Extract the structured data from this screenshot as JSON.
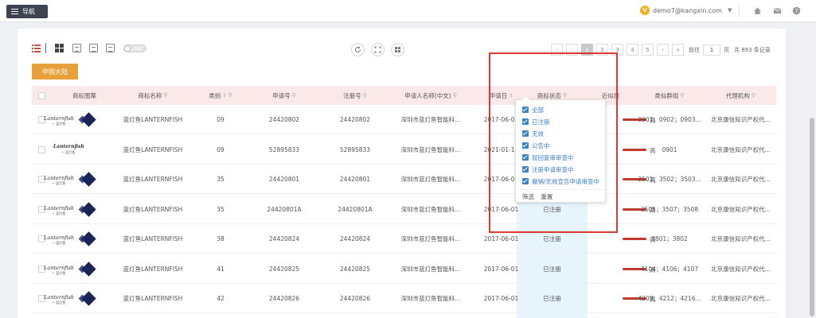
{
  "topbar": {
    "nav_label": "导航",
    "vip_label": "V",
    "user_email": "demo7@kangxin.com",
    "user_caret": "▼",
    "icons": [
      "home-icon",
      "mail-icon",
      "help-icon"
    ]
  },
  "toolbar": {
    "toggle_label": "关闭",
    "china_button": "中国大陆"
  },
  "pagination": {
    "pages": [
      "1",
      "2",
      "3",
      "4",
      "5"
    ],
    "active_page": "1",
    "goto_label": "前往",
    "page_value": "1",
    "page_unit": "页",
    "total": "共 893 条记录"
  },
  "table": {
    "columns": [
      "商标图案",
      "商标名称",
      "类别",
      "申请号",
      "注册号",
      "申请人名称(中文)",
      "申请日",
      "商标状态",
      "近似度",
      "类似群组",
      "代理机构"
    ],
    "rows": [
      {
        "name": "蓝灯鱼LANTERNFISH",
        "class": "09",
        "app_no": "24420802",
        "reg_no": "24420802",
        "applicant": "深圳市蓝灯鱼智能科...",
        "date": "2017-06-01",
        "status": "",
        "sim": "高",
        "groups": "0901；0902；0903...",
        "agency": "北京康信知识产权代...",
        "logo_type": "mark"
      },
      {
        "name": "蓝灯鱼LANTERNFISH",
        "class": "09",
        "app_no": "52895833",
        "reg_no": "52895833",
        "applicant": "深圳市蓝灯鱼智能科...",
        "date": "2021-01-11",
        "status": "",
        "sim": "高",
        "groups": "0901",
        "agency": "北京康信知识产权代...",
        "logo_type": "text"
      },
      {
        "name": "蓝灯鱼LANTERNFISH",
        "class": "35",
        "app_no": "24420801",
        "reg_no": "24420801",
        "applicant": "深圳市蓝灯鱼智能科...",
        "date": "2017-06-01",
        "status": "",
        "sim": "高",
        "groups": "3501；3502；3503...",
        "agency": "北京康信知识产权代...",
        "logo_type": "mark"
      },
      {
        "name": "蓝灯鱼LANTERNFISH",
        "class": "35",
        "app_no": "24420801A",
        "reg_no": "24420801A",
        "applicant": "深圳市蓝灯鱼智能科...",
        "date": "2017-06-01",
        "status": "已注册",
        "sim": "高",
        "groups": "3505；3507；3508",
        "agency": "北京康信知识产权代...",
        "logo_type": "mark"
      },
      {
        "name": "蓝灯鱼LANTERNFISH",
        "class": "38",
        "app_no": "24420824",
        "reg_no": "24420824",
        "applicant": "深圳市蓝灯鱼智能科...",
        "date": "2017-06-01",
        "status": "已注册",
        "sim": "高",
        "groups": "3801；3802",
        "agency": "北京康信知识产权代...",
        "logo_type": "mark"
      },
      {
        "name": "蓝灯鱼LANTERNFISH",
        "class": "41",
        "app_no": "24420825",
        "reg_no": "24420825",
        "applicant": "深圳市蓝灯鱼智能科...",
        "date": "2017-06-01",
        "status": "已注册",
        "sim": "高",
        "groups": "4104；4106；4107",
        "agency": "北京康信知识产权代...",
        "logo_type": "mark"
      },
      {
        "name": "蓝灯鱼LANTERNFISH",
        "class": "42",
        "app_no": "24420826",
        "reg_no": "24420826",
        "applicant": "深圳市蓝灯鱼智能科...",
        "date": "2017-06-01",
        "status": "已注册",
        "sim": "高",
        "groups": "4209；4212；4216...",
        "agency": "北京康信知识产权代...",
        "logo_type": "mark"
      }
    ],
    "logo_text": "Lanternfish",
    "logo_sub": "一 蓝灯鱼"
  },
  "status_filter": {
    "options": [
      "全部",
      "已注册",
      "无效",
      "公告中",
      "驳回复审审查中",
      "注册申请审查中",
      "撤销/无效宣告申请审查中"
    ],
    "filter_label": "筛选",
    "reset_label": "重置"
  },
  "colors": {
    "accent": "#c64b3f",
    "china_button": "#e8a03a",
    "highlight_box": "#d93a32",
    "check_blue": "#3b82c4"
  }
}
